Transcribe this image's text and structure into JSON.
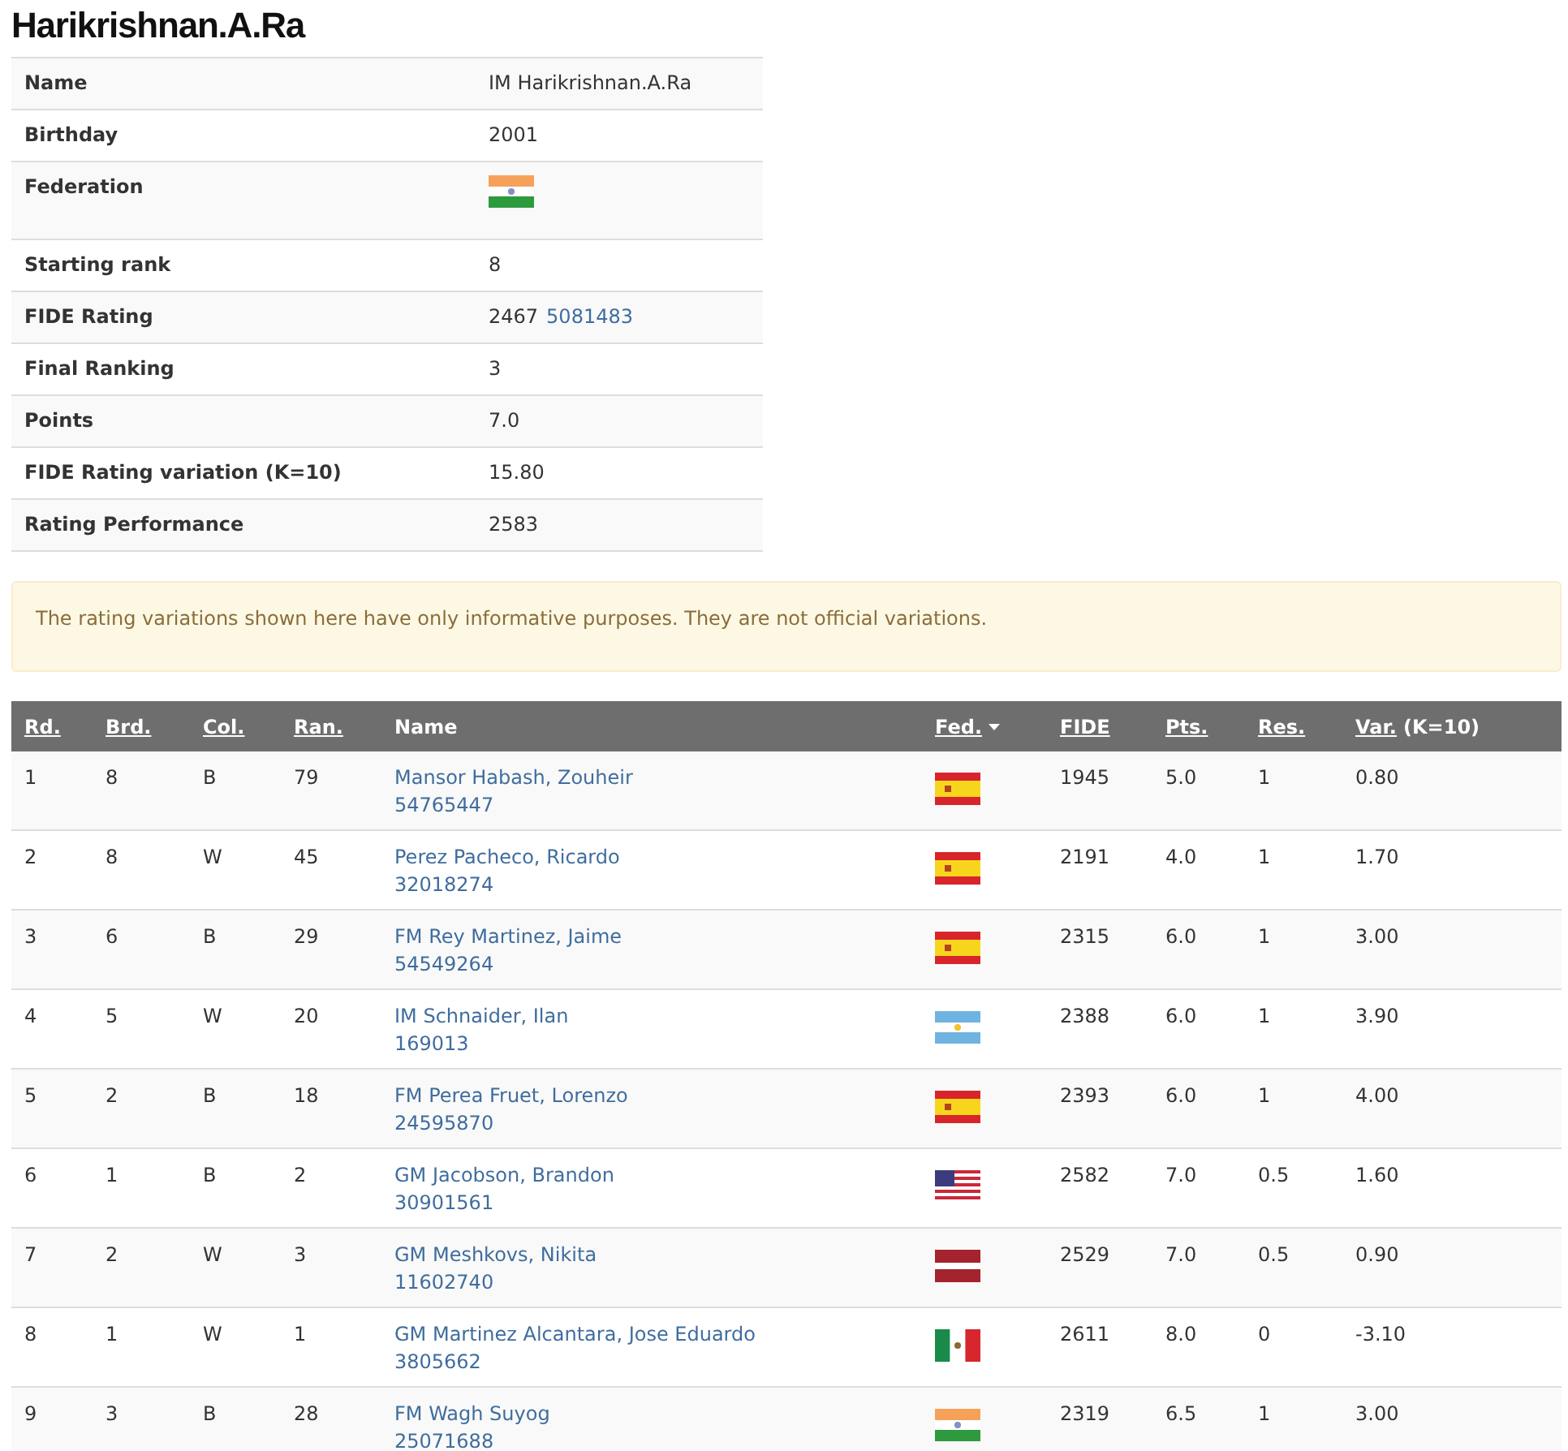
{
  "title": "Harikrishnan.A.Ra",
  "info": [
    {
      "label": "Name",
      "value": "IM Harikrishnan.A.Ra"
    },
    {
      "label": "Birthday",
      "value": "2001"
    },
    {
      "label": "Federation",
      "flag": {
        "kind": "in"
      }
    },
    {
      "label": "Starting rank",
      "value": "8"
    },
    {
      "label": "FIDE Rating",
      "value": "2467",
      "link": "5081483"
    },
    {
      "label": "Final Ranking",
      "value": "3"
    },
    {
      "label": "Points",
      "value": "7.0"
    },
    {
      "label": "FIDE Rating variation (K=10)",
      "value": "15.80"
    },
    {
      "label": "Rating Performance",
      "value": "2583"
    }
  ],
  "notice": "The rating variations shown here have only informative purposes. They are not official variations.",
  "columns": [
    {
      "label": "Rd.",
      "sortable": true
    },
    {
      "label": "Brd.",
      "sortable": true
    },
    {
      "label": "Col.",
      "sortable": true
    },
    {
      "label": "Ran.",
      "sortable": true
    },
    {
      "label": "Name",
      "sortable": false
    },
    {
      "label": "Fed.",
      "sortable": true,
      "sorted": true
    },
    {
      "label": "FIDE",
      "sortable": true
    },
    {
      "label": "Pts.",
      "sortable": true
    },
    {
      "label": "Res.",
      "sortable": true
    },
    {
      "label": "Var.",
      "sortable": true,
      "suffix": "(K=10)"
    }
  ],
  "rows": [
    {
      "rd": "1",
      "brd": "8",
      "col": "B",
      "ran": "79",
      "name": "Mansor Habash, Zouheir",
      "id": "54765447",
      "flag": {
        "kind": "es"
      },
      "fide": "1945",
      "pts": "5.0",
      "res": "1",
      "var": "0.80"
    },
    {
      "rd": "2",
      "brd": "8",
      "col": "W",
      "ran": "45",
      "name": "Perez Pacheco, Ricardo",
      "id": "32018274",
      "flag": {
        "kind": "es"
      },
      "fide": "2191",
      "pts": "4.0",
      "res": "1",
      "var": "1.70"
    },
    {
      "rd": "3",
      "brd": "6",
      "col": "B",
      "ran": "29",
      "name": "FM Rey Martinez, Jaime",
      "id": "54549264",
      "flag": {
        "kind": "es"
      },
      "fide": "2315",
      "pts": "6.0",
      "res": "1",
      "var": "3.00"
    },
    {
      "rd": "4",
      "brd": "5",
      "col": "W",
      "ran": "20",
      "name": "IM Schnaider, Ilan",
      "id": "169013",
      "flag": {
        "kind": "ar"
      },
      "fide": "2388",
      "pts": "6.0",
      "res": "1",
      "var": "3.90"
    },
    {
      "rd": "5",
      "brd": "2",
      "col": "B",
      "ran": "18",
      "name": "FM Perea Fruet, Lorenzo",
      "id": "24595870",
      "flag": {
        "kind": "es"
      },
      "fide": "2393",
      "pts": "6.0",
      "res": "1",
      "var": "4.00"
    },
    {
      "rd": "6",
      "brd": "1",
      "col": "B",
      "ran": "2",
      "name": "GM Jacobson, Brandon",
      "id": "30901561",
      "flag": {
        "kind": "us"
      },
      "fide": "2582",
      "pts": "7.0",
      "res": "0.5",
      "var": "1.60"
    },
    {
      "rd": "7",
      "brd": "2",
      "col": "W",
      "ran": "3",
      "name": "GM Meshkovs, Nikita",
      "id": "11602740",
      "flag": {
        "kind": "lv"
      },
      "fide": "2529",
      "pts": "7.0",
      "res": "0.5",
      "var": "0.90"
    },
    {
      "rd": "8",
      "brd": "1",
      "col": "W",
      "ran": "1",
      "name": "GM Martinez Alcantara, Jose Eduardo",
      "id": "3805662",
      "flag": {
        "kind": "mx"
      },
      "fide": "2611",
      "pts": "8.0",
      "res": "0",
      "var": "-3.10"
    },
    {
      "rd": "9",
      "brd": "3",
      "col": "B",
      "ran": "28",
      "name": "FM Wagh Suyog",
      "id": "25071688",
      "flag": {
        "kind": "in"
      },
      "fide": "2319",
      "pts": "6.5",
      "res": "1",
      "var": "3.00"
    }
  ]
}
